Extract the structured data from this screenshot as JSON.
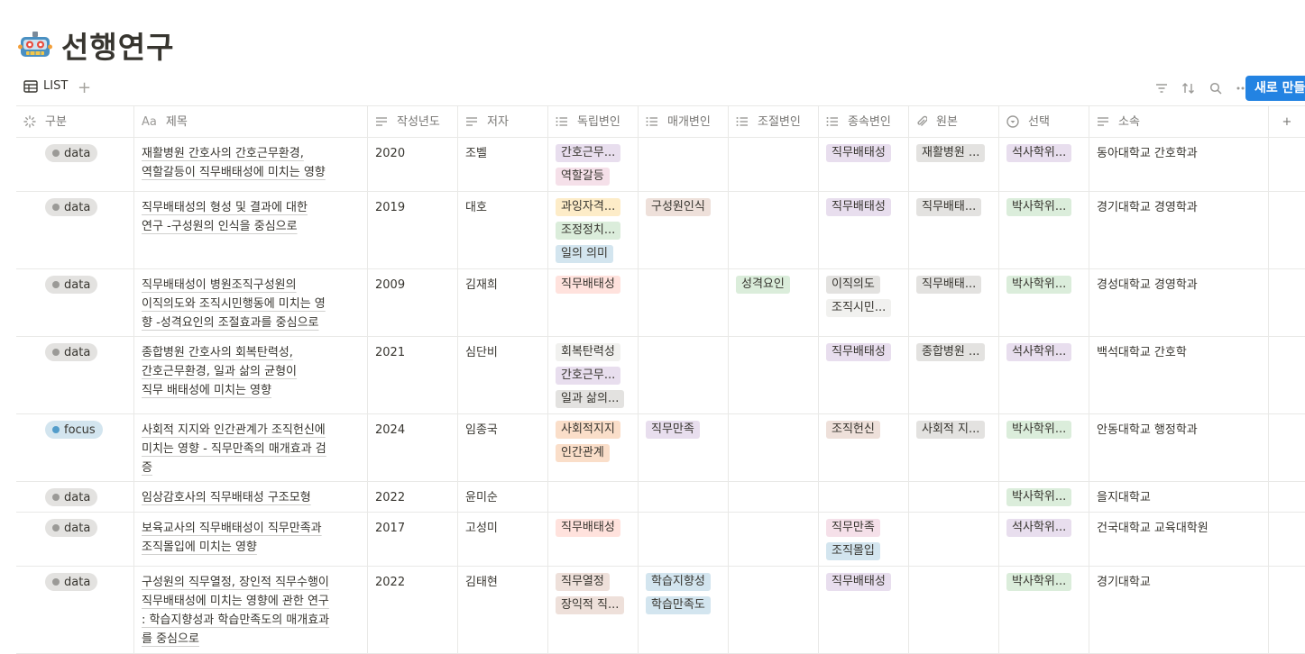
{
  "page": {
    "title": "선행연구",
    "icon": "robot-icon"
  },
  "toolbar": {
    "view_label": "LIST",
    "new_button": "새로 만들기"
  },
  "columns": [
    {
      "label": "구분",
      "icon": "loading-icon"
    },
    {
      "label": "제목",
      "icon": "text-aa-icon"
    },
    {
      "label": "작성년도",
      "icon": "lines-icon"
    },
    {
      "label": "저자",
      "icon": "lines-icon"
    },
    {
      "label": "독립변인",
      "icon": "list-icon"
    },
    {
      "label": "매개변인",
      "icon": "list-icon"
    },
    {
      "label": "조절변인",
      "icon": "list-icon"
    },
    {
      "label": "종속변인",
      "icon": "list-icon"
    },
    {
      "label": "원본",
      "icon": "paperclip-icon"
    },
    {
      "label": "선택",
      "icon": "select-icon"
    },
    {
      "label": "소속",
      "icon": "lines-icon"
    }
  ],
  "colors": {
    "accent": "#2383e2",
    "data_dot": "#9b9a97",
    "focus_dot": "#529cca"
  },
  "rows": [
    {
      "type": "data",
      "type_color": "gray",
      "title": [
        "재활병원 간호사의 간호근무환경,",
        "역할갈등이 직무배태성에 미치는 영향"
      ],
      "year": "2020",
      "author": "조벨",
      "iv": [
        {
          "t": "간호근무...",
          "c": "purple"
        },
        {
          "t": "역할갈등",
          "c": "pink"
        }
      ],
      "mv": [],
      "modv": [],
      "dv": [
        {
          "t": "직무배태성",
          "c": "purple"
        }
      ],
      "src": [
        {
          "t": "재활병원 ...",
          "c": "gray"
        }
      ],
      "sel": [
        {
          "t": "석사학위...",
          "c": "purple"
        }
      ],
      "aff": "동아대학교 간호학과",
      "h": 59
    },
    {
      "type": "data",
      "type_color": "gray",
      "title": [
        "직무배태성의 형성 및 결과에 대한",
        "연구 -구성원의 인식을 중심으로"
      ],
      "year": "2019",
      "author": "대호",
      "iv": [
        {
          "t": "과잉자격...",
          "c": "ylw"
        },
        {
          "t": "조정정치...",
          "c": "green"
        },
        {
          "t": "일의 의미",
          "c": "blue"
        }
      ],
      "mv": [
        {
          "t": "구성원인식",
          "c": "brown"
        }
      ],
      "modv": [],
      "dv": [
        {
          "t": "직무배태성",
          "c": "purple"
        }
      ],
      "src": [
        {
          "t": "직무배태...",
          "c": "gray"
        }
      ],
      "sel": [
        {
          "t": "박사학위...",
          "c": "green"
        }
      ],
      "aff": "경기대학교 경영학과",
      "h": 85
    },
    {
      "type": "data",
      "type_color": "gray",
      "title": [
        "직무배태성이 병원조직구성원의",
        "이직의도와 조직시민행동에 미치는 영",
        "향 -성격요인의 조절효과를 중심으로"
      ],
      "year": "2009",
      "author": "김재희",
      "iv": [
        {
          "t": "직무배태성",
          "c": "red"
        }
      ],
      "mv": [],
      "modv": [
        {
          "t": "성격요인",
          "c": "green"
        }
      ],
      "dv": [
        {
          "t": "이직의도",
          "c": "gray"
        },
        {
          "t": "조직시민...",
          "c": "lgray"
        }
      ],
      "src": [
        {
          "t": "직무배태...",
          "c": "gray"
        }
      ],
      "sel": [
        {
          "t": "박사학위...",
          "c": "green"
        }
      ],
      "aff": "경성대학교 경영학과",
      "h": 74
    },
    {
      "type": "data",
      "type_color": "gray",
      "title": [
        "종합병원 간호사의 회복탄력성,",
        "간호근무환경, 일과 삶의 균형이",
        "직무 배태성에 미치는 영향"
      ],
      "year": "2021",
      "author": "심단비",
      "iv": [
        {
          "t": "회복탄력성",
          "c": "lgray"
        },
        {
          "t": "간호근무...",
          "c": "purple"
        },
        {
          "t": "일과 삶의...",
          "c": "gray"
        }
      ],
      "mv": [],
      "modv": [],
      "dv": [
        {
          "t": "직무배태성",
          "c": "purple"
        }
      ],
      "src": [
        {
          "t": "종합병원 ...",
          "c": "gray"
        }
      ],
      "sel": [
        {
          "t": "석사학위...",
          "c": "purple"
        }
      ],
      "aff": "백석대학교 간호학",
      "h": 85
    },
    {
      "type": "focus",
      "type_color": "blue",
      "title": [
        "사회적 지지와 인간관계가 조직헌신에",
        "미치는 영향 - 직무만족의 매개효과 검",
        "증"
      ],
      "year": "2024",
      "author": "임종국",
      "iv": [
        {
          "t": "사회적지지",
          "c": "orange"
        },
        {
          "t": "인간관계",
          "c": "orange"
        }
      ],
      "mv": [
        {
          "t": "직무만족",
          "c": "purple"
        }
      ],
      "modv": [],
      "dv": [
        {
          "t": "조직헌신",
          "c": "brown"
        }
      ],
      "src": [
        {
          "t": "사회적 지...",
          "c": "gray"
        }
      ],
      "sel": [
        {
          "t": "박사학위...",
          "c": "green"
        }
      ],
      "aff": "안동대학교 행정학과",
      "h": 74
    },
    {
      "type": "data",
      "type_color": "gray",
      "title": [
        "임상감호사의 직무배태성 구조모형"
      ],
      "year": "2022",
      "author": "윤미순",
      "iv": [],
      "mv": [],
      "modv": [],
      "dv": [],
      "src": [],
      "sel": [
        {
          "t": "박사학위...",
          "c": "green"
        }
      ],
      "aff": "을지대학교",
      "h": 33
    },
    {
      "type": "data",
      "type_color": "gray",
      "title": [
        "보육교사의 직무배태성이 직무만족과",
        "조직몰입에 미치는 영향"
      ],
      "year": "2017",
      "author": "고성미",
      "iv": [
        {
          "t": "직무배태성",
          "c": "red"
        }
      ],
      "mv": [],
      "modv": [],
      "dv": [
        {
          "t": "직무만족",
          "c": "pink"
        },
        {
          "t": "조직몰입",
          "c": "blue"
        }
      ],
      "src": [],
      "sel": [
        {
          "t": "석사학위...",
          "c": "purple"
        }
      ],
      "aff": "건국대학교 교육대학원",
      "h": 59
    },
    {
      "type": "data",
      "type_color": "gray",
      "title": [
        "구성원의 직무열정, 장인적 직무수행이",
        "직무배태성에 미치는 영향에 관한 연구",
        ": 학습지향성과 학습만족도의 매개효과",
        "를 중심으로"
      ],
      "year": "2022",
      "author": "김태현",
      "iv": [
        {
          "t": "직무열정",
          "c": "brown"
        },
        {
          "t": "장익적 직...",
          "c": "brown"
        }
      ],
      "mv": [
        {
          "t": "학습지향성",
          "c": "blue"
        },
        {
          "t": "학습만족도",
          "c": "blue"
        }
      ],
      "modv": [],
      "dv": [
        {
          "t": "직무배태성",
          "c": "purple"
        }
      ],
      "src": [],
      "sel": [
        {
          "t": "박사학위...",
          "c": "green"
        }
      ],
      "aff": "경기대학교",
      "h": 96
    }
  ]
}
